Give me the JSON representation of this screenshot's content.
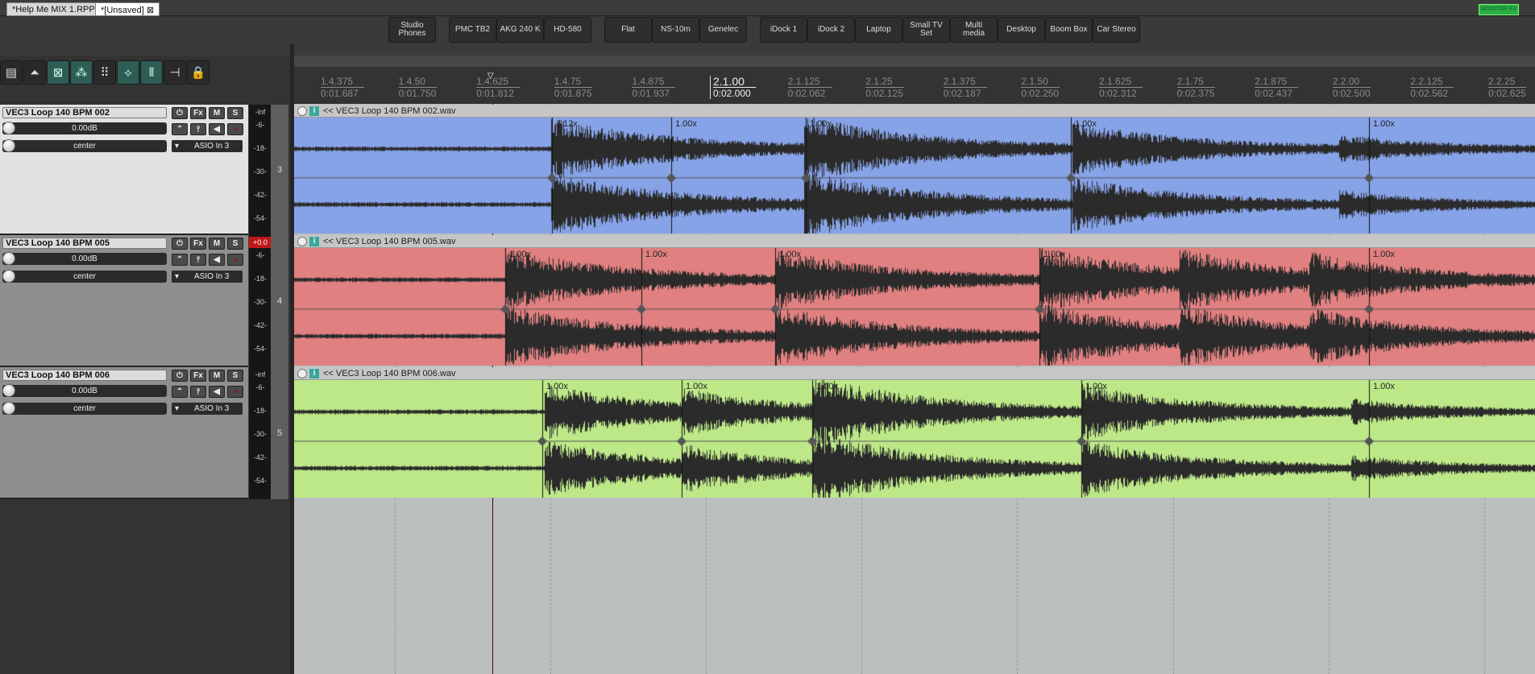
{
  "tabs": [
    {
      "label": "*Help Me MIX 1.RPP"
    },
    {
      "label": "*[Unsaved]"
    }
  ],
  "monitor_fx": "MONITOR FX",
  "presets": [
    [
      "Studio\nPhones"
    ],
    [
      "PMC TB2",
      "AKG 240 K",
      "HD-580"
    ],
    [
      "Flat",
      "NS-10m",
      "Genelec"
    ],
    [
      "iDock 1",
      "iDock 2",
      "Laptop",
      "Small TV\nSet",
      "Multi\nmedia",
      "Desktop",
      "Boom Box",
      "Car Stereo"
    ]
  ],
  "tools": [
    {
      "icon": "track-icon"
    },
    {
      "icon": "metronome-icon"
    },
    {
      "icon": "ripple-icon",
      "on": true
    },
    {
      "icon": "grouping-icon",
      "on": true
    },
    {
      "icon": "grid-icon"
    },
    {
      "icon": "envelope-icon",
      "on": true
    },
    {
      "icon": "snap-icon",
      "on": true
    },
    {
      "icon": "split-icon"
    },
    {
      "icon": "lock-icon"
    }
  ],
  "ruler": [
    {
      "beat": "1.4.375",
      "time": "0:01.687"
    },
    {
      "beat": "1.4.50",
      "time": "0:01.750"
    },
    {
      "beat": "1.4.625",
      "time": "0:01.812"
    },
    {
      "beat": "1.4.75",
      "time": "0:01.875"
    },
    {
      "beat": "1.4.875",
      "time": "0:01.937"
    },
    {
      "beat": "2.1.00",
      "time": "0:02.000",
      "major": true
    },
    {
      "beat": "2.1.125",
      "time": "0:02.062"
    },
    {
      "beat": "2.1.25",
      "time": "0:02.125"
    },
    {
      "beat": "2.1.375",
      "time": "0:02.187"
    },
    {
      "beat": "2.1.50",
      "time": "0:02.250"
    },
    {
      "beat": "2.1.625",
      "time": "0:02.312"
    },
    {
      "beat": "2.1.75",
      "time": "0:02.375"
    },
    {
      "beat": "2.1.875",
      "time": "0:02.437"
    },
    {
      "beat": "2.2.00",
      "time": "0:02.500"
    },
    {
      "beat": "2.2.125",
      "time": "0:02.562"
    },
    {
      "beat": "2.2.25",
      "time": "0:02.625"
    }
  ],
  "buttons": {
    "power": "⏻",
    "fx": "Fx",
    "mute": "M",
    "solo": "S"
  },
  "meter_labels": [
    "-6-",
    "-18-",
    "-30-",
    "-42-",
    "-54-"
  ],
  "tracks": [
    {
      "name": "VEC3 Loop 140 BPM 002",
      "volume": "0.00dB",
      "pan": "center",
      "input": "ASIO In 3",
      "peak": "-inf",
      "number": "3",
      "clip": "<< VEC3 Loop 140 BPM 002.wav",
      "color": "#87a3e8",
      "panel": "#e2e2e2",
      "rates": [
        "1.12x",
        "1.00x",
        "1.00x",
        "1.00x",
        "1.00x"
      ]
    },
    {
      "name": "VEC3 Loop 140 BPM 005",
      "volume": "0.00dB",
      "pan": "center",
      "input": "ASIO In 3",
      "peak": "+0.0",
      "clipped": true,
      "number": "4",
      "clip": "<< VEC3 Loop 140 BPM 005.wav",
      "color": "#e08080",
      "panel": "#8f8f8f",
      "rates": [
        "1.00x",
        "1.00x",
        "1.00x",
        "1.00x",
        "1.00x"
      ]
    },
    {
      "name": "VEC3 Loop 140 BPM 006",
      "volume": "0.00dB",
      "pan": "center",
      "input": "ASIO In 3",
      "peak": "-inf",
      "number": "5",
      "clip": "<< VEC3 Loop 140 BPM 006.wav",
      "color": "#bde888",
      "panel": "#8f8f8f",
      "rates": [
        "1.00x",
        "1.00x",
        "1.00x",
        "1.00x",
        "1.00x"
      ]
    }
  ]
}
